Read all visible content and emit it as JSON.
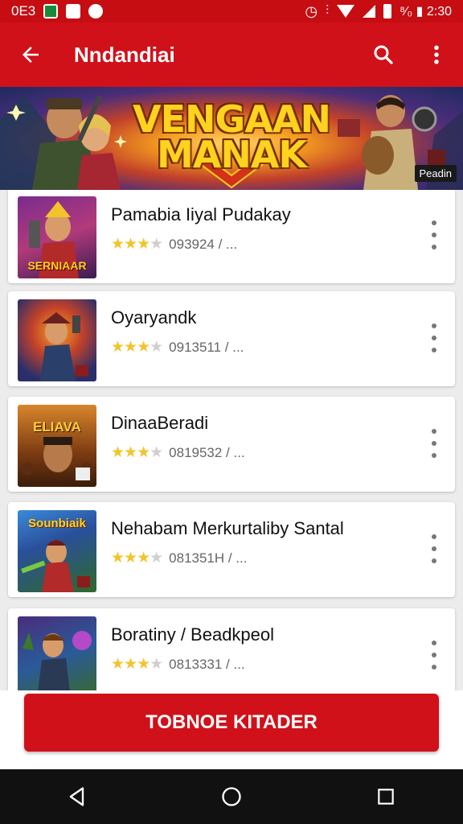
{
  "status_bar": {
    "left_text": "0E3",
    "right_text": "⁸⁄₀ ▮ 2:30",
    "icons": [
      "mail-icon",
      "image-icon",
      "location-icon",
      "alarm-icon",
      "vibrate-icon",
      "wifi-icon",
      "signal-icon",
      "battery-icon"
    ]
  },
  "app_bar": {
    "title": "Nndandiai",
    "icons": [
      "back-arrow-icon",
      "search-icon",
      "more-vert-icon"
    ]
  },
  "banner": {
    "title_line1": "VENGAAN",
    "title_line2": "MANAK",
    "badge": "Peadin"
  },
  "games": [
    {
      "name": "Pamabia Iiyal Pudakay",
      "meta": "093924 / ...",
      "rating": 3
    },
    {
      "name": "Oyaryandk",
      "meta": "0913511 / ...",
      "rating": 3
    },
    {
      "name": "DinaaBeradi",
      "meta": "0819532 / ...",
      "rating": 3
    },
    {
      "name": "Nehabam Merkurtaliby Santal",
      "meta": "081351H / ...",
      "rating": 3
    },
    {
      "name": "Boratiny / Beadkpeol",
      "meta": "0813331 / ...",
      "rating": 3
    }
  ],
  "thumb_labels": [
    "SERNIAAR",
    "",
    "ELIAVA",
    "Sounbiaik",
    ""
  ],
  "primary_button": {
    "label": "TOBNOE KITADER"
  },
  "colors": {
    "brand_red": "#d0111a",
    "star": "#f2c42b"
  }
}
